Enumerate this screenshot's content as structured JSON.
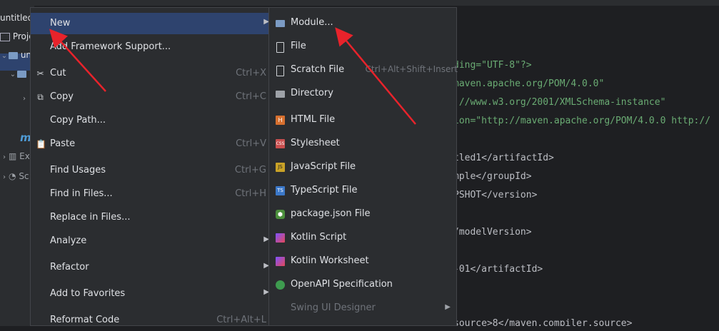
{
  "project": {
    "title": "untitled",
    "tool_window": "Proje",
    "tree": [
      {
        "label": "un",
        "arrow": "⌄"
      },
      {
        "label": "",
        "arrow": "⌄"
      },
      {
        "label": "",
        "arrow": "›"
      },
      {
        "label": "m",
        "arrow": ""
      },
      {
        "label": "Ex",
        "arrow": "›"
      },
      {
        "label": "Sc",
        "arrow": "›"
      }
    ]
  },
  "editor": {
    "lines": [
      "ding=\"UTF-8\"?>",
      "maven.apache.org/POM/4.0.0\"",
      "://www.w3.org/2001/XMLSchema-instance\"",
      "ion=\"http://maven.apache.org/POM/4.0.0 http://",
      "tled1</artifactId>",
      "mple</groupId>",
      "PSHOT</version>",
      "/modelVersion>",
      "-01</artifactId>",
      "source>8</maven.compiler.source>"
    ]
  },
  "menu": {
    "items": [
      {
        "label": "New",
        "shortcut": "",
        "submenu": true
      },
      {
        "label": "Add Framework Support...",
        "shortcut": ""
      },
      {
        "label": "Cut",
        "shortcut": "Ctrl+X"
      },
      {
        "label": "Copy",
        "shortcut": "Ctrl+C"
      },
      {
        "label": "Copy Path...",
        "shortcut": ""
      },
      {
        "label": "Paste",
        "shortcut": "Ctrl+V"
      },
      {
        "label": "Find Usages",
        "shortcut": "Ctrl+G"
      },
      {
        "label": "Find in Files...",
        "shortcut": "Ctrl+H"
      },
      {
        "label": "Replace in Files...",
        "shortcut": ""
      },
      {
        "label": "Analyze",
        "shortcut": "",
        "submenu": true
      },
      {
        "label": "Refactor",
        "shortcut": "",
        "submenu": true
      },
      {
        "label": "Add to Favorites",
        "shortcut": "",
        "submenu": true
      },
      {
        "label": "Reformat Code",
        "shortcut": "Ctrl+Alt+L"
      }
    ]
  },
  "submenu": {
    "items": [
      {
        "label": "Module...",
        "shortcut": "",
        "icon": "module-icon"
      },
      {
        "label": "File",
        "shortcut": "",
        "icon": "file-icon"
      },
      {
        "label": "Scratch File",
        "shortcut": "Ctrl+Alt+Shift+Insert",
        "icon": "scratch-file-icon"
      },
      {
        "label": "Directory",
        "shortcut": "",
        "icon": "folder-icon"
      },
      {
        "label": "HTML File",
        "shortcut": "",
        "icon": "html-file-icon",
        "badge": "H"
      },
      {
        "label": "Stylesheet",
        "shortcut": "",
        "icon": "css-file-icon",
        "badge": "CSS"
      },
      {
        "label": "JavaScript File",
        "shortcut": "",
        "icon": "js-file-icon",
        "badge": "JS"
      },
      {
        "label": "TypeScript File",
        "shortcut": "",
        "icon": "ts-file-icon",
        "badge": "TS"
      },
      {
        "label": "package.json File",
        "shortcut": "",
        "icon": "nodejs-icon"
      },
      {
        "label": "Kotlin Script",
        "shortcut": "",
        "icon": "kotlin-icon"
      },
      {
        "label": "Kotlin Worksheet",
        "shortcut": "",
        "icon": "kotlin-icon"
      },
      {
        "label": "OpenAPI Specification",
        "shortcut": "",
        "icon": "openapi-icon"
      },
      {
        "label": "Swing UI Designer",
        "shortcut": "",
        "icon": "",
        "disabled": true,
        "submenu": true
      }
    ]
  },
  "colors": {
    "menu_bg": "#2b2d30",
    "selection": "#2e436e",
    "annotation_arrow": "#e8232b"
  }
}
